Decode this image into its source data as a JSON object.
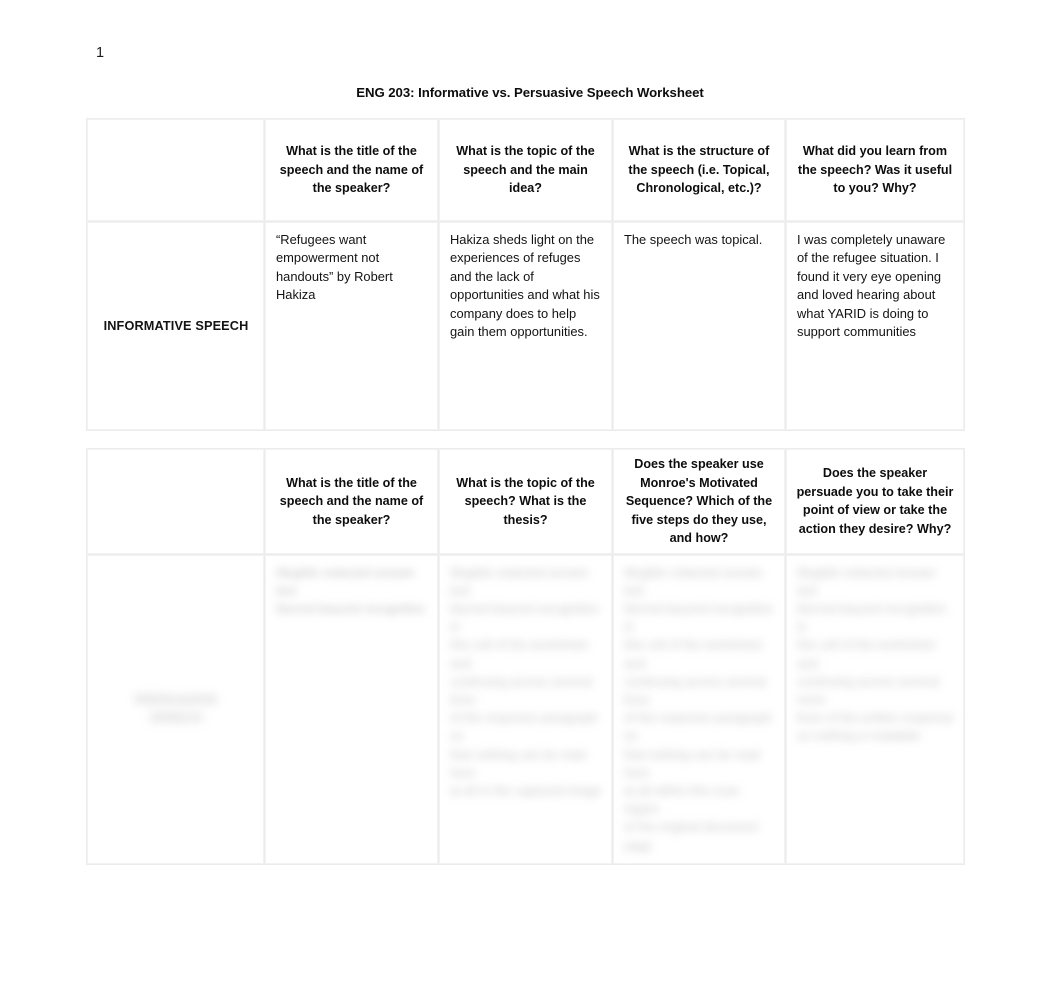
{
  "document": {
    "page_number": "1",
    "title": "ENG 203: Informative vs. Persuasive Speech Worksheet"
  },
  "informative_table": {
    "headers": {
      "label_column": "",
      "col_a": "What is the title of the speech and the name of the speaker?",
      "col_b": "What is the topic of the speech and the main idea?",
      "col_c": "What is the structure of the speech (i.e. Topical, Chronological, etc.)?",
      "col_d": "What did you learn from the speech? Was it useful to you? Why?"
    },
    "row": {
      "label": "INFORMATIVE SPEECH",
      "col_a": "“Refugees want empowerment not handouts” by Robert Hakiza",
      "col_b": "Hakiza sheds light on the experiences of refuges and the lack of opportunities and what his company does to help gain them opportunities.",
      "col_c": "The speech was topical.",
      "col_d": "I was completely unaware of the refugee situation. I found it very eye opening and loved hearing about what YARID is doing to support communities"
    }
  },
  "persuasive_table": {
    "headers": {
      "label_column": "",
      "col_a": "What is the title of the speech and the name of the speaker?",
      "col_b": "What is the topic of the speech? What is the thesis?",
      "col_c": "Does the speaker use Monroe's Motivated Sequence? Which of the five steps do they use, and how?",
      "col_d": "Does the speaker persuade you to take their point of view or take the action they desire? Why?"
    },
    "row": {
      "label_redacted": "PERSUASIVE\nSPEECH",
      "col_a_redacted": "Illegible redacted answer text\nblurred beyond recognition",
      "col_b_redacted": "Illegible redacted answer text\nblurred beyond recognition in\nthis cell of the worksheet and\ncontinuing across several lines\nof the response paragraph so\nthat nothing can be read here\nat all in the captured image",
      "col_c_redacted": "Illegible redacted answer text\nblurred beyond recognition in\nthis cell of the worksheet and\ncontinuing across several lines\nof the response paragraph so\nthat nothing can be read here\nat all within this scan region\nof the original document page",
      "col_d_redacted": "Illegible redacted answer text\nblurred beyond recognition in\nthis cell of the worksheet and\ncontinuing across several more\nlines of the written response\nso nothing is readable"
    }
  }
}
